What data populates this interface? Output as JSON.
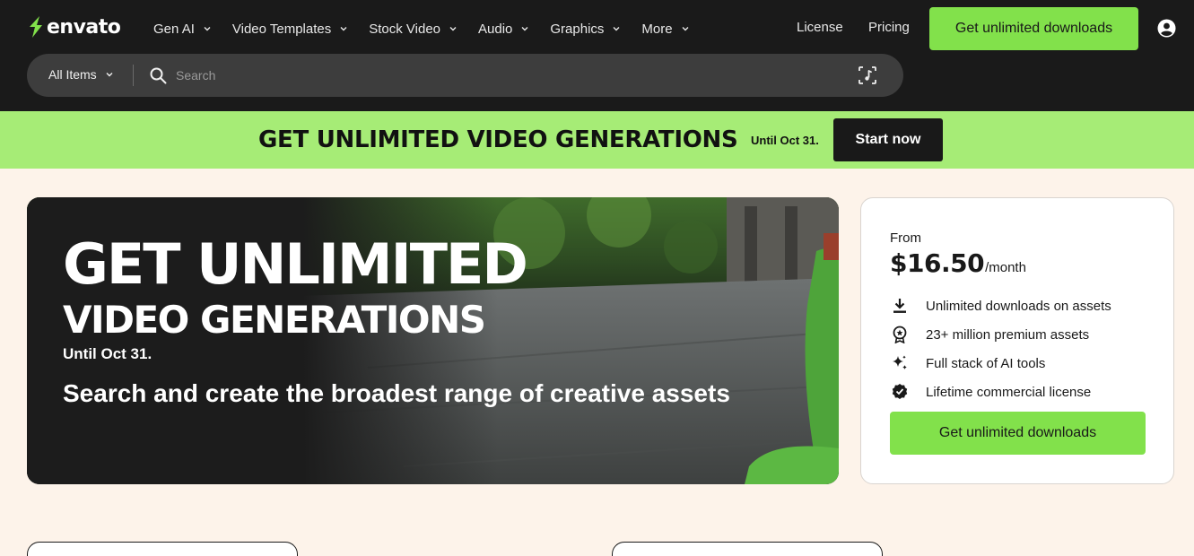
{
  "header": {
    "logo_text": "envato",
    "nav": [
      {
        "label": "Gen AI"
      },
      {
        "label": "Video Templates"
      },
      {
        "label": "Stock Video"
      },
      {
        "label": "Audio"
      },
      {
        "label": "Graphics"
      },
      {
        "label": "More"
      }
    ],
    "license_label": "License",
    "pricing_label": "Pricing",
    "cta_label": "Get unlimited downloads"
  },
  "search": {
    "category_label": "All Items",
    "placeholder": "Search"
  },
  "promo": {
    "title": "GET UNLIMITED VIDEO GENERATIONS",
    "subtitle": "Until Oct 31.",
    "button_label": "Start now"
  },
  "hero": {
    "line1": "GET UNLIMITED",
    "line2": "VIDEO GENERATIONS",
    "date": "Until Oct 31.",
    "tagline": "Search and create the broadest range of creative assets"
  },
  "pricing": {
    "from_label": "From",
    "amount": "$16.50",
    "period": "/month",
    "features": [
      {
        "icon": "download-icon",
        "label": "Unlimited downloads on assets"
      },
      {
        "icon": "award-icon",
        "label": "23+ million premium assets"
      },
      {
        "icon": "sparkle-icon",
        "label": "Full stack of AI tools"
      },
      {
        "icon": "verified-badge-icon",
        "label": "Lifetime commercial license"
      }
    ],
    "button_label": "Get unlimited downloads"
  },
  "colors": {
    "accent_green": "#82e14b",
    "promo_green": "#a6ec76",
    "header_bg": "#1a1a1a",
    "page_bg": "#fdf3ea"
  }
}
